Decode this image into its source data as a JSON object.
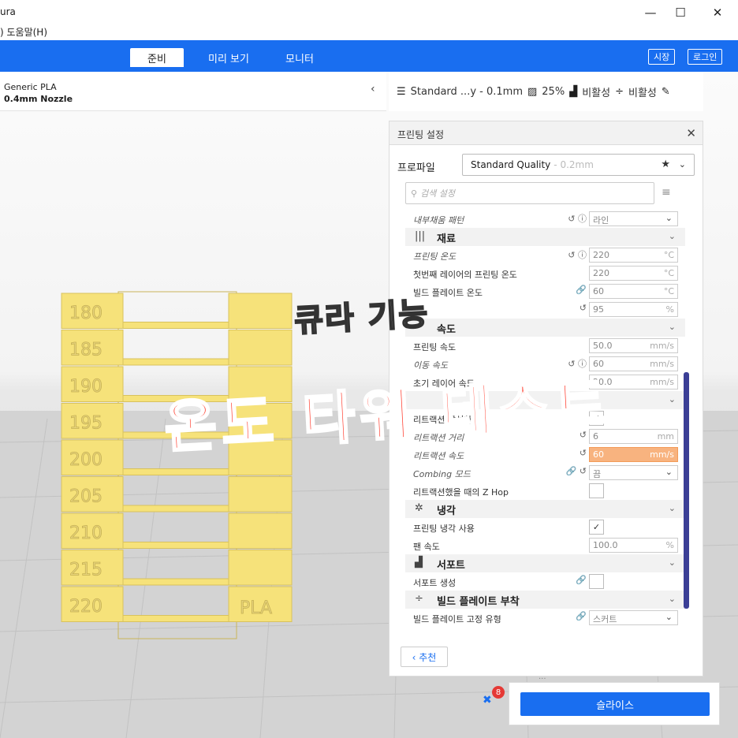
{
  "window": {
    "title": "ura",
    "menu": ") 도움말(H)",
    "minimize": "—",
    "maximize": "☐",
    "close": "✕"
  },
  "header": {
    "tabs": [
      {
        "label": "준비",
        "active": true
      },
      {
        "label": "미리 보기",
        "active": false
      },
      {
        "label": "모니터",
        "active": false
      }
    ],
    "marketplace_label": "시장",
    "login_label": "로그인",
    "accent": "#196ef0"
  },
  "material": {
    "name": "Generic PLA",
    "nozzle": "0.4mm Nozzle",
    "chevron": "‹"
  },
  "summary": {
    "profile": "Standard ...y - 0.1mm",
    "infill": "25%",
    "support": "비활성",
    "adhesion": "비활성"
  },
  "print_settings": {
    "title": "프린팅 설정",
    "close": "✕",
    "profile_label": "프로파일",
    "profile_value": "Standard Quality",
    "profile_layer": "- 0.2mm",
    "search_placeholder": "검색 설정",
    "rows": [
      {
        "type": "select",
        "label": "내부채움 패턴",
        "italic": true,
        "icons": "↺ ⓘ",
        "value": "라인"
      },
      {
        "type": "section",
        "label": "재료",
        "icon": "|||"
      },
      {
        "type": "field",
        "label": "프린팅 온도",
        "italic": true,
        "icons": "↺ ⓘ",
        "value": "220",
        "unit": "°C"
      },
      {
        "type": "field",
        "label": "첫번째 레이어의 프린팅 온도",
        "value": "220",
        "unit": "°C"
      },
      {
        "type": "field",
        "label": "빌드 플레이트 온도",
        "icons": "🔗",
        "value": "60",
        "unit": "°C"
      },
      {
        "type": "field",
        "label": "",
        "icons": "↺",
        "value": "95",
        "unit": "%"
      },
      {
        "type": "section",
        "label": "속도",
        "icon": ""
      },
      {
        "type": "field",
        "label": "프린팅 속도",
        "value": "50.0",
        "unit": "mm/s"
      },
      {
        "type": "field",
        "label": "이동 속도",
        "italic": true,
        "icons": "↺ ⓘ",
        "value": "60",
        "unit": "mm/s"
      },
      {
        "type": "field",
        "label": "초기 레이어 속도",
        "value": "20.0",
        "unit": "mm/s"
      },
      {
        "type": "section",
        "label": "",
        "icon": ""
      },
      {
        "type": "check",
        "label": "리트랙션 활성화",
        "checked": true
      },
      {
        "type": "field",
        "label": "리트랙션 거리",
        "italic": true,
        "icons": "↺",
        "value": "6",
        "unit": "mm"
      },
      {
        "type": "field",
        "label": "리트랙션 속도",
        "italic": true,
        "icons": "↺",
        "value": "60",
        "unit": "mm/s",
        "warning": true
      },
      {
        "type": "select",
        "label": "Combing 모드",
        "italic": true,
        "icons": "🔗 ↺",
        "value": "끔"
      },
      {
        "type": "check",
        "label": "리트랙션했을 때의 Z Hop",
        "checked": false
      },
      {
        "type": "section",
        "label": "냉각",
        "icon": "✲"
      },
      {
        "type": "check",
        "label": "프린팅 냉각 사용",
        "checked": true
      },
      {
        "type": "field",
        "label": "팬 속도",
        "value": "100.0",
        "unit": "%"
      },
      {
        "type": "section",
        "label": "서포트",
        "icon": "▟"
      },
      {
        "type": "check",
        "label": "서포트 생성",
        "icons": "🔗",
        "checked": false
      },
      {
        "type": "section",
        "label": "빌드 플레이트 부착",
        "icon": "÷"
      },
      {
        "type": "select",
        "label": "빌드 플레이트 고정 유형",
        "icons": "🔗",
        "value": "스커트"
      }
    ],
    "recommended_label": "‹ 추천"
  },
  "slice": {
    "label": "슬라이스",
    "badge": "8"
  },
  "tower": {
    "labels": [
      "180",
      "185",
      "190",
      "195",
      "200",
      "205",
      "210",
      "215",
      "220"
    ],
    "base_label": "PLA",
    "color": "#f6e27a"
  },
  "overlay": {
    "subtitle": "큐라 기능",
    "title": "온도 타워 테스트"
  }
}
